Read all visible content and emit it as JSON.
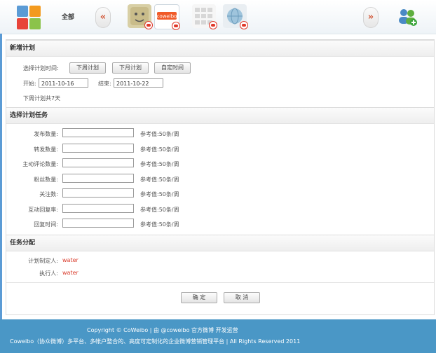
{
  "topbar": {
    "all_label": "全部",
    "prev_arrow": "«",
    "next_arrow": "»",
    "accounts": [
      {
        "name": "face-account"
      },
      {
        "name": "coweibo-account",
        "logo_text": "coweibo"
      },
      {
        "name": "grid-account"
      },
      {
        "name": "globe-account"
      }
    ]
  },
  "plan": {
    "heading": "新增计划",
    "select_time_label": "选择计划时间:",
    "btn_next_week": "下周计划",
    "btn_next_month": "下月计划",
    "btn_custom": "自定时间",
    "start_label": "开始:",
    "start_value": "2011-10-16",
    "end_label": "结束:",
    "end_value": "2011-10-22",
    "summary": "下周计划共7天"
  },
  "tasks": {
    "heading": "选择计划任务",
    "rows": [
      {
        "label": "发布数量:",
        "value": "",
        "ref": "参考值:50条/周"
      },
      {
        "label": "转发数量:",
        "value": "",
        "ref": "参考值:50条/周"
      },
      {
        "label": "主动评论数量:",
        "value": "",
        "ref": "参考值:50条/周"
      },
      {
        "label": "粉丝数量:",
        "value": "",
        "ref": "参考值:50条/周"
      },
      {
        "label": "关注数:",
        "value": "",
        "ref": "参考值:50条/周"
      },
      {
        "label": "互动回复率:",
        "value": "",
        "ref": "参考值:50条/周"
      },
      {
        "label": "回复时间:",
        "value": "",
        "ref": "参考值:50条/周"
      }
    ]
  },
  "assign": {
    "heading": "任务分配",
    "maker_label": "计划制定人:",
    "maker_value": "water",
    "executor_label": "执行人:",
    "executor_value": "water"
  },
  "actions": {
    "confirm": "确 定",
    "cancel": "取 消"
  },
  "footer": {
    "line1": "Copyright © CoWeibo  |  由 @coweibo 官方微博 开发运营",
    "line2": "Coweibo（协众微博）多平台、多帐户整合的、高度可定制化的企业微博营销管理平台  |  All Rights Reserved 2011"
  },
  "colors": {
    "accent_red": "#d93b2b",
    "footer_blue": "#4a97c6"
  }
}
